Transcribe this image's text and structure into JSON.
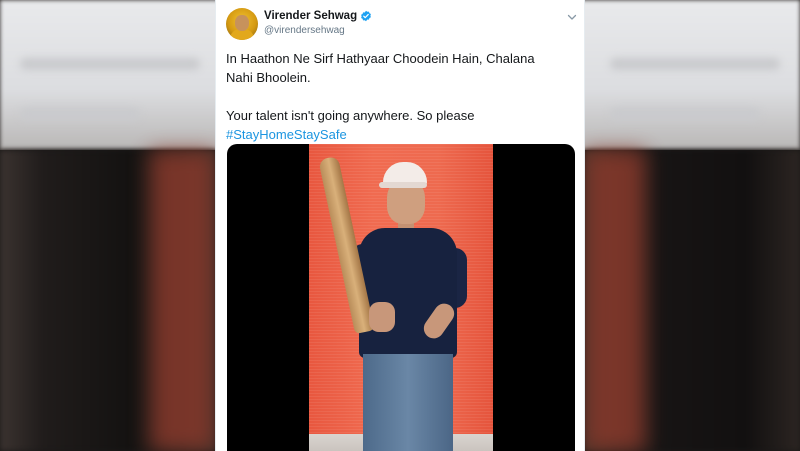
{
  "tweet": {
    "display_name": "Virender Sehwag",
    "handle": "@virendersehwag",
    "verified": true,
    "text_line1": "In Haathon Ne Sirf Hathyaar Choodein Hain, Chalana",
    "text_line2": "Nahi Bhoolein.",
    "text_line3": "Your talent isn't going anywhere. So please",
    "hashtag": "#StayHomeStaySafe"
  },
  "icons": {
    "verified": "verified-badge-icon",
    "more": "chevron-down-icon"
  },
  "colors": {
    "link": "#1b95e0",
    "verified": "#1da1f2",
    "text": "#14171a",
    "secondary": "#657786"
  }
}
